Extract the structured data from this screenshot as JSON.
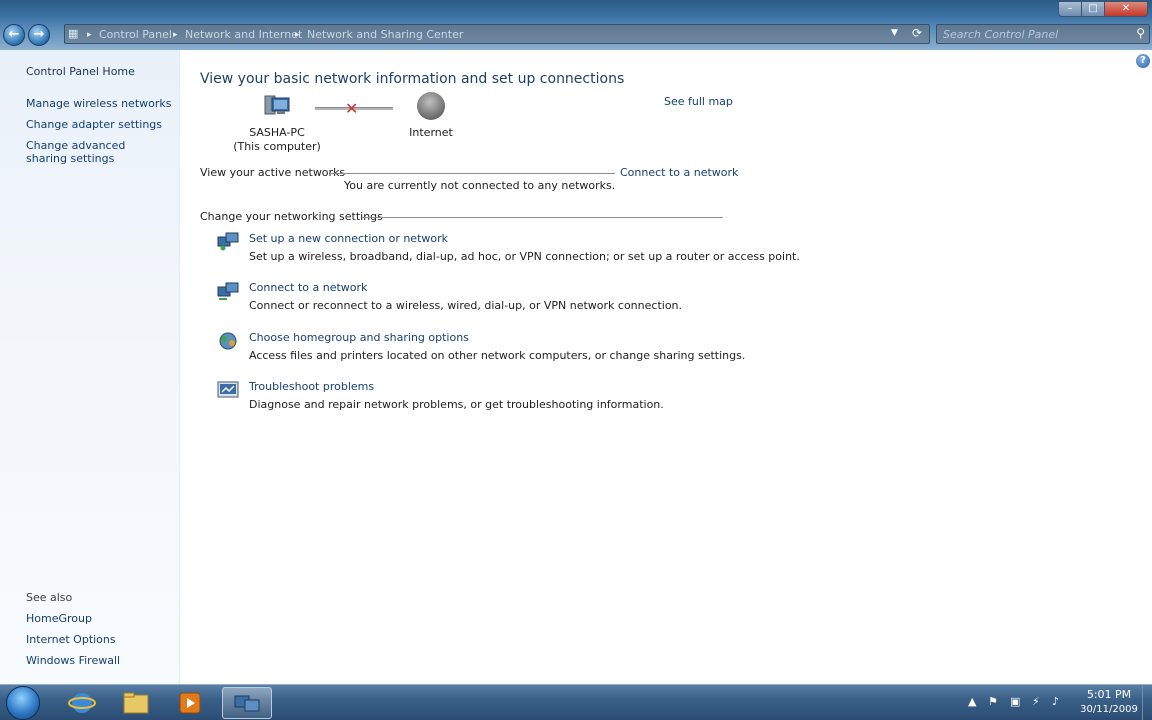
{
  "titlebar": {
    "minimize": "–",
    "maximize": "□",
    "close": "✕"
  },
  "address": {
    "crumbs": [
      "Control Panel",
      "Network and Internet",
      "Network and Sharing Center"
    ],
    "search_placeholder": "Search Control Panel"
  },
  "sidebar": {
    "home": "Control Panel Home",
    "links": [
      "Manage wireless networks",
      "Change adapter settings",
      "Change advanced sharing settings"
    ],
    "see_also_label": "See also",
    "see_also": [
      "HomeGroup",
      "Internet Options",
      "Windows Firewall"
    ]
  },
  "main": {
    "title": "View your basic network information and set up connections",
    "see_full_map": "See full map",
    "computer_name": "SASHA-PC",
    "computer_sub": "(This computer)",
    "internet": "Internet",
    "active_networks_label": "View your active networks",
    "connect_to_network": "Connect to a network",
    "not_connected": "You are currently not connected to any networks.",
    "settings_label": "Change your networking settings",
    "tasks": [
      {
        "link": "Set up a new connection or network",
        "desc": "Set up a wireless, broadband, dial-up, ad hoc, or VPN connection; or set up a router or access point."
      },
      {
        "link": "Connect to a network",
        "desc": "Connect or reconnect to a wireless, wired, dial-up, or VPN network connection."
      },
      {
        "link": "Choose homegroup and sharing options",
        "desc": "Access files and printers located on other network computers, or change sharing settings."
      },
      {
        "link": "Troubleshoot problems",
        "desc": "Diagnose and repair network problems, or get troubleshooting information."
      }
    ]
  },
  "taskbar": {
    "time": "5:01 PM",
    "date": "30/11/2009"
  }
}
